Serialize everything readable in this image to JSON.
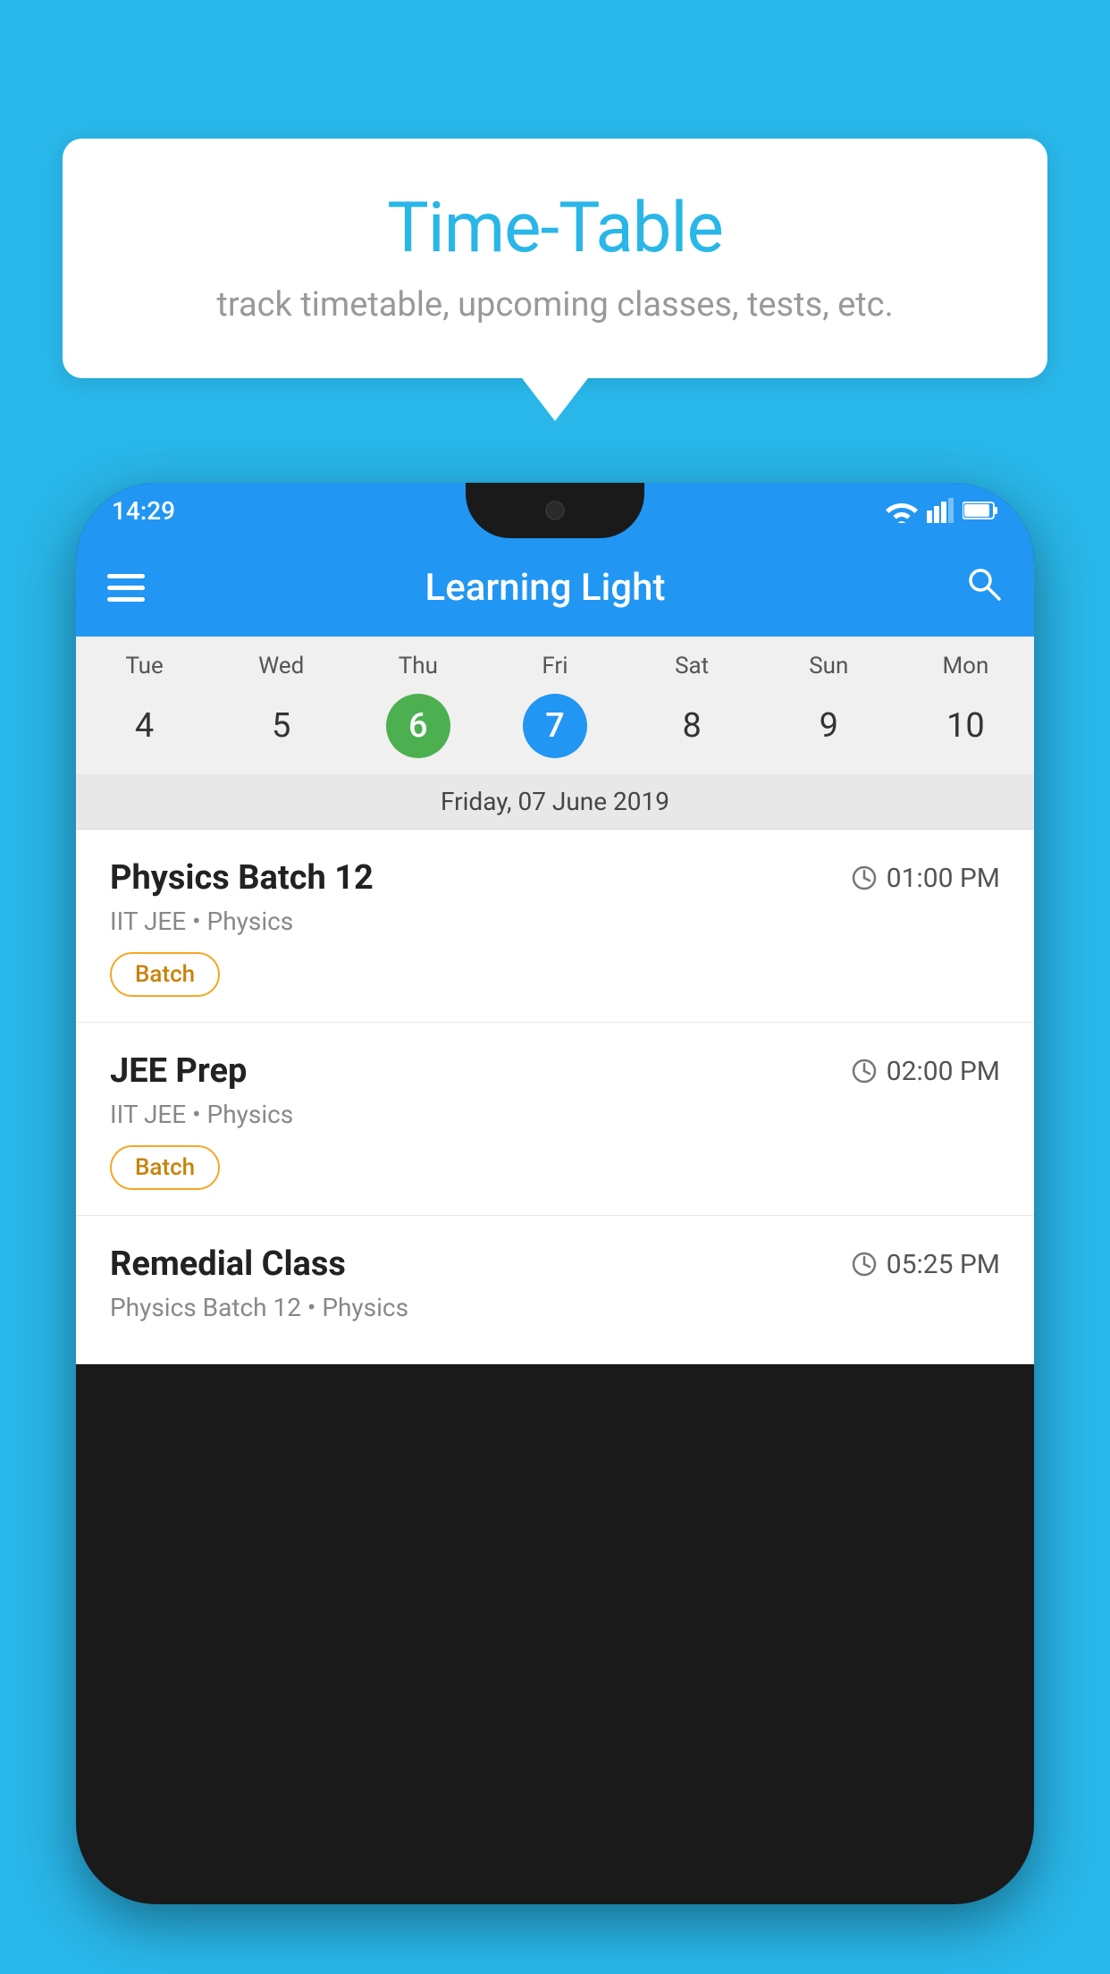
{
  "background_color": "#29b6e8",
  "bubble": {
    "title": "Time-Table",
    "subtitle": "track timetable, upcoming classes, tests, etc."
  },
  "phone": {
    "status_bar": {
      "time": "14:29"
    },
    "app_bar": {
      "title": "Learning Light"
    },
    "calendar": {
      "days_of_week": [
        "Tue",
        "Wed",
        "Thu",
        "Fri",
        "Sat",
        "Sun",
        "Mon"
      ],
      "dates": [
        "4",
        "5",
        "6",
        "7",
        "8",
        "9",
        "10"
      ],
      "today_index": 2,
      "selected_index": 3,
      "selected_date_label": "Friday, 07 June 2019"
    },
    "schedule": [
      {
        "title": "Physics Batch 12",
        "time": "01:00 PM",
        "subtitle": "IIT JEE • Physics",
        "badge": "Batch"
      },
      {
        "title": "JEE Prep",
        "time": "02:00 PM",
        "subtitle": "IIT JEE • Physics",
        "badge": "Batch"
      },
      {
        "title": "Remedial Class",
        "time": "05:25 PM",
        "subtitle": "Physics Batch 12 • Physics",
        "badge": null
      }
    ]
  }
}
